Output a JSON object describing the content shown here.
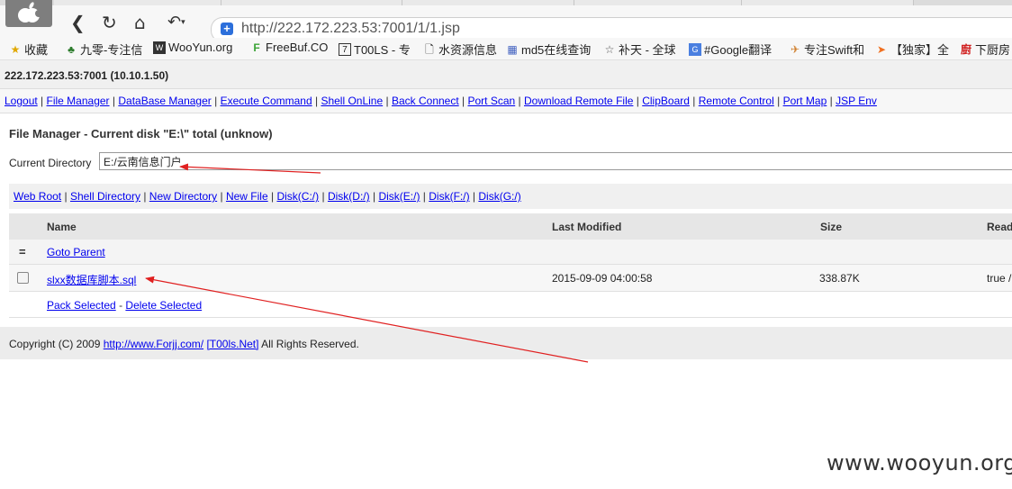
{
  "browser": {
    "url": "http://222.172.223.53:7001/1/1.jsp",
    "bookmarks": [
      "收藏",
      "九零-专注信",
      "WooYun.org",
      "FreeBuf.CO",
      "T00LS - 专",
      "水资源信息",
      "md5在线查询",
      "补天 - 全球",
      "#Google翻译",
      "专注Swift和",
      "【独家】全",
      "下厨房"
    ]
  },
  "host": "222.172.223.53:7001 (10.10.1.50)",
  "menu": [
    "Logout",
    "File Manager",
    "DataBase Manager",
    "Execute Command",
    "Shell OnLine",
    "Back Connect",
    "Port Scan",
    "Download Remote File",
    "ClipBoard",
    "Remote Control",
    "Port Map",
    "JSP Env"
  ],
  "file_manager": {
    "title": "File Manager - Current disk \"E:\\\" total (unknow)",
    "current_directory_label": "Current Directory",
    "current_directory_value": "E:/云南信息门户",
    "links": [
      "Web Root",
      "Shell Directory",
      "New Directory",
      "New File",
      "Disk(C:/)",
      "Disk(D:/)",
      "Disk(E:/)",
      "Disk(F:/)",
      "Disk(G:/)"
    ],
    "columns": [
      "Name",
      "Last Modified",
      "Size",
      "Read"
    ],
    "parent_marker": "=",
    "parent_label": "Goto Parent",
    "rows": [
      {
        "name": "slxx数据库脚本.sql",
        "modified": "2015-09-09 04:00:58",
        "size": "338.87K",
        "read": "true /"
      }
    ],
    "pack_selected": "Pack Selected",
    "action_separator": "-",
    "delete_selected": "Delete Selected"
  },
  "footer": {
    "prefix": "Copyright (C) 2009",
    "link1": "http://www.Forjj.com/",
    "link2": "[T00ls.Net]",
    "suffix": "All Rights Reserved."
  },
  "watermark": "www.wooyun.org",
  "colors": {
    "link": "#0000ee",
    "annotation_arrow": "#e02020"
  }
}
